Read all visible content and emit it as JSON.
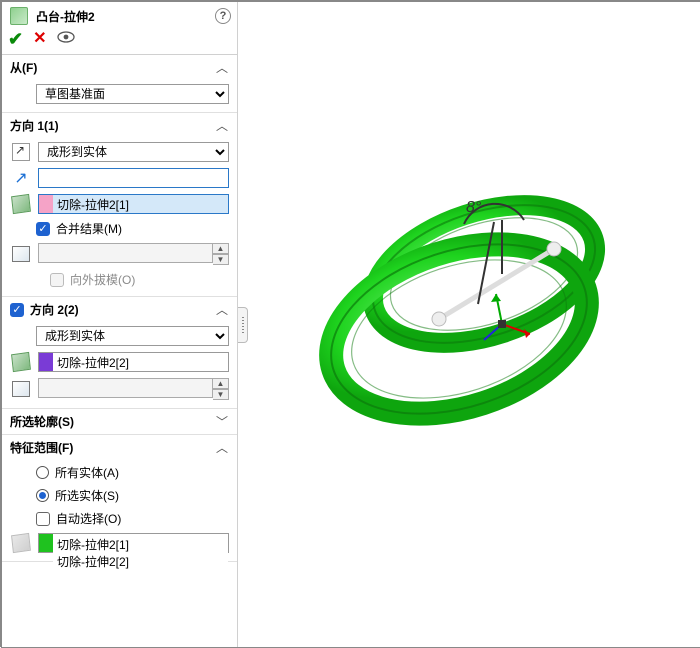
{
  "header": {
    "title": "凸台-拉伸2"
  },
  "sections": {
    "from": {
      "title": "从(F)",
      "value": "草图基准面"
    },
    "dir1": {
      "title": "方向 1(1)",
      "endcond": "成形到实体",
      "bodyTarget": "切除-拉伸2[1]",
      "mergeLabel": "合并结果(M)",
      "draftOutwardLabel": "向外拔模(O)"
    },
    "dir2": {
      "title": "方向 2(2)",
      "endcond": "成形到实体",
      "bodyTarget": "切除-拉伸2[2]"
    },
    "contours": {
      "title": "所选轮廓(S)"
    },
    "scope": {
      "title": "特征范围(F)",
      "allLabel": "所有实体(A)",
      "selLabel": "所选实体(S)",
      "autoLabel": "自动选择(O)",
      "items": [
        "切除-拉伸2[1]",
        "切除-拉伸2[2]"
      ]
    }
  },
  "viewport": {
    "angleLabel": "8°"
  }
}
